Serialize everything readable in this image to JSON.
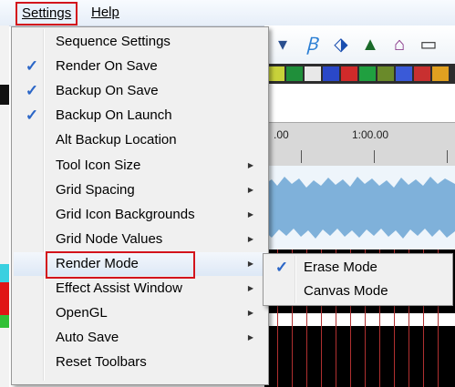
{
  "menubar": {
    "settings_label": "Settings",
    "help_label": "Help"
  },
  "settings_menu": {
    "items": [
      {
        "label": "Sequence Settings",
        "checked": false,
        "submenu": false
      },
      {
        "label": "Render On Save",
        "checked": true,
        "submenu": false
      },
      {
        "label": "Backup On Save",
        "checked": true,
        "submenu": false
      },
      {
        "label": "Backup On Launch",
        "checked": true,
        "submenu": false
      },
      {
        "label": "Alt Backup Location",
        "checked": false,
        "submenu": false
      },
      {
        "label": "Tool Icon Size",
        "checked": false,
        "submenu": true
      },
      {
        "label": "Grid Spacing",
        "checked": false,
        "submenu": true
      },
      {
        "label": "Grid Icon Backgrounds",
        "checked": false,
        "submenu": true
      },
      {
        "label": "Grid Node Values",
        "checked": false,
        "submenu": true
      },
      {
        "label": "Render Mode",
        "checked": false,
        "submenu": true,
        "highlighted": true
      },
      {
        "label": "Effect Assist Window",
        "checked": false,
        "submenu": true
      },
      {
        "label": "OpenGL",
        "checked": false,
        "submenu": true
      },
      {
        "label": "Auto Save",
        "checked": false,
        "submenu": true
      },
      {
        "label": "Reset Toolbars",
        "checked": false,
        "submenu": false
      }
    ]
  },
  "render_mode_submenu": {
    "items": [
      {
        "label": "Erase Mode",
        "checked": true
      },
      {
        "label": "Canvas Mode",
        "checked": false
      }
    ]
  },
  "timeline": {
    "ruler_left_label": ".00",
    "ruler_right_label": "1:00.00"
  },
  "glyphs": {
    "check": "✓",
    "arrow": "▶"
  }
}
